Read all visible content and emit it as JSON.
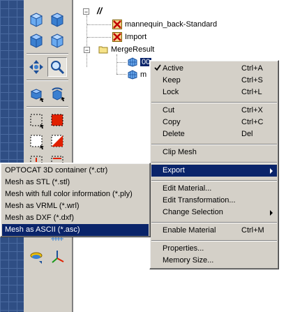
{
  "tree": {
    "root_label": "//",
    "items": [
      {
        "label": "mannequin_back-Standard",
        "icon": "red-x-icon"
      },
      {
        "label": "Import",
        "icon": "red-x-icon"
      },
      {
        "label": "MergeResult",
        "icon": "folder-icon"
      },
      {
        "label": "00",
        "icon": "mesh-icon"
      },
      {
        "label": "m",
        "icon": "mesh-icon"
      }
    ]
  },
  "context_menu": {
    "items": [
      {
        "label": "Active",
        "shortcut": "Ctrl+A",
        "checked": true
      },
      {
        "label": "Keep",
        "shortcut": "Ctrl+S"
      },
      {
        "label": "Lock",
        "shortcut": "Ctrl+L"
      },
      {
        "label": "Cut",
        "shortcut": "Ctrl+X"
      },
      {
        "label": "Copy",
        "shortcut": "Ctrl+C"
      },
      {
        "label": "Delete",
        "shortcut": "Del"
      },
      {
        "label": "Clip Mesh",
        "shortcut": ""
      },
      {
        "label": "Export",
        "shortcut": "",
        "submenu": true
      },
      {
        "label": "Edit Material...",
        "shortcut": ""
      },
      {
        "label": "Edit Transformation...",
        "shortcut": ""
      },
      {
        "label": "Change Selection",
        "shortcut": "",
        "submenu": true
      },
      {
        "label": "Enable Material",
        "shortcut": "Ctrl+M"
      },
      {
        "label": "Properties...",
        "shortcut": ""
      },
      {
        "label": "Memory Size...",
        "shortcut": ""
      }
    ]
  },
  "export_submenu": {
    "items": [
      "OPTOCAT 3D container (*.ctr)",
      "Mesh as STL (*.stl)",
      "Mesh with full color information (*.ply)",
      "Mesh as VRML (*.wrl)",
      "Mesh as DXF (*.dxf)",
      "Mesh as ASCII (*.asc)"
    ],
    "highlighted": "Mesh as ASCII (*.asc)"
  },
  "colors": {
    "highlight": "#0a246a",
    "menu_bg": "#d4d0c8",
    "cube_blue": "#3a7fd0",
    "selection_red": "#e02000"
  }
}
